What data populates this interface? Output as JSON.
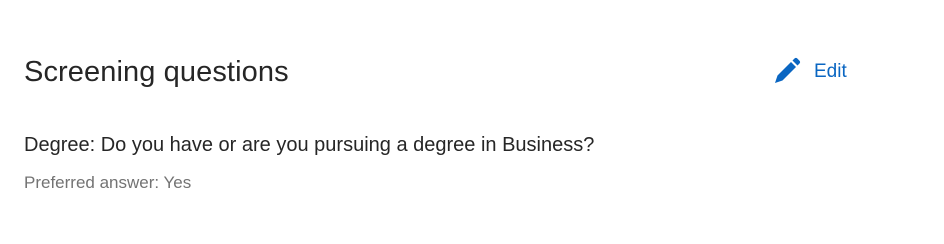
{
  "section": {
    "title": "Screening questions",
    "edit_label": "Edit",
    "edit_icon": "pencil-icon"
  },
  "questions": [
    {
      "text": "Degree: Do you have or are you pursuing a degree in Business?",
      "preferred_answer": "Preferred answer: Yes"
    }
  ],
  "colors": {
    "accent": "#0a66c2",
    "text_primary": "#262626",
    "text_secondary": "#737373"
  }
}
